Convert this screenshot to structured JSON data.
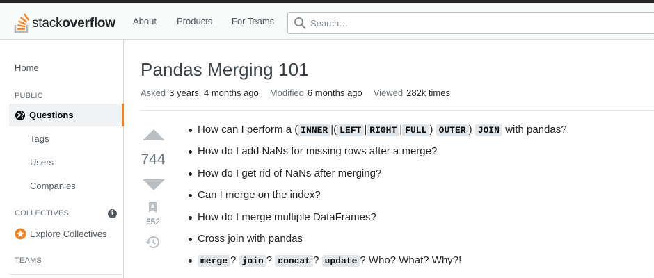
{
  "colors": {
    "accent": "#f48225",
    "topbar": "#262626",
    "sidebar_active_bg": "#f1f2f3"
  },
  "logo": {
    "text_light": "stack",
    "text_bold": "overflow",
    "icon": "stack-overflow-logo-icon"
  },
  "nav": {
    "items": [
      "About",
      "Products",
      "For Teams"
    ]
  },
  "search": {
    "placeholder": "Search…",
    "value": "",
    "icon": "search-icon"
  },
  "sidebar": {
    "home": "Home",
    "public_heading": "PUBLIC",
    "questions": "Questions",
    "questions_icon": "globe-icon",
    "sub_items": [
      "Tags",
      "Users",
      "Companies"
    ],
    "collectives_heading": "COLLECTIVES",
    "collectives_info_icon": "info-icon",
    "explore_collectives": "Explore Collectives",
    "explore_icon": "collectives-star-icon",
    "teams_heading": "TEAMS"
  },
  "question": {
    "title": "Pandas Merging 101",
    "asked_label": "Asked",
    "asked_value": "3 years, 4 months ago",
    "modified_label": "Modified",
    "modified_value": "6 months ago",
    "viewed_label": "Viewed",
    "viewed_value": "282k times",
    "votes": "744",
    "bookmarks": "652",
    "icons": [
      "upvote-arrow-icon",
      "downvote-arrow-icon",
      "bookmark-icon",
      "history-icon"
    ]
  },
  "bullets": {
    "b1": {
      "t0": "How can I perform a (",
      "c1": "INNER",
      "t1": "|(",
      "c2": "LEFT",
      "t2": "|",
      "c3": "RIGHT",
      "t3": "|",
      "c4": "FULL",
      "t4": ")",
      "c5": "OUTER",
      "t5": ")",
      "c6": "JOIN",
      "t6": " with pandas?"
    },
    "b2": "How do I add NaNs for missing rows after a merge?",
    "b3": "How do I get rid of NaNs after merging?",
    "b4": "Can I merge on the index?",
    "b5": "How do I merge multiple DataFrames?",
    "b6": "Cross join with pandas",
    "b7": {
      "c1": "merge",
      "t1": "?",
      "c2": "join",
      "t2": "?",
      "c3": "concat",
      "t3": "?",
      "c4": "update",
      "t4": "? Who? What? Why?!"
    }
  }
}
